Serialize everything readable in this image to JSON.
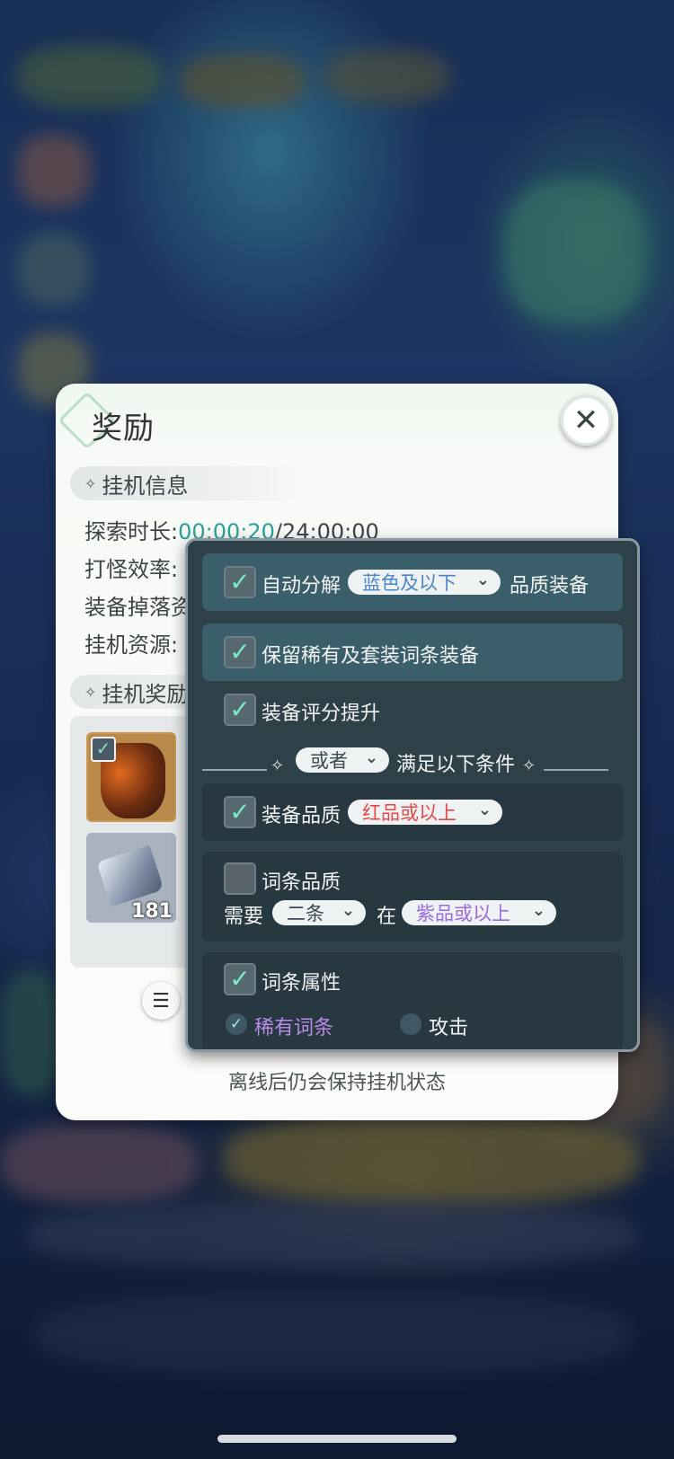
{
  "card": {
    "title": "奖励",
    "close_icon": "✕",
    "idle_info": {
      "section_label": "挂机信息",
      "explore_label": "探索时长:",
      "explore_elapsed": "00:00:20",
      "explore_total": "/24:00:00",
      "kill_rate_label": "打怪效率:",
      "drop_label": "装备掉落资",
      "resource_label": "挂机资源:"
    },
    "rewards": {
      "section_label": "挂机奖励",
      "items": [
        {
          "name": "armor",
          "checked": true
        },
        {
          "name": "ore",
          "count": "181"
        }
      ]
    },
    "offline_note": "离线后仍会保持挂机状态"
  },
  "filter_panel": {
    "auto_salvage": {
      "checked": true,
      "label": "自动分解",
      "dropdown": "蓝色及以下",
      "suffix": "品质装备"
    },
    "keep_rare": {
      "checked": true,
      "label": "保留稀有及套装词条装备"
    },
    "score_up": {
      "checked": true,
      "label": "装备评分提升"
    },
    "divider": {
      "dropdown": "或者",
      "text": "满足以下条件"
    },
    "equip_quality": {
      "checked": true,
      "label": "装备品质",
      "dropdown": "红品或以上"
    },
    "affix_quality": {
      "checked": false,
      "label": "词条品质",
      "need_label": "需要",
      "count_dropdown": "二条",
      "at_label": "在",
      "quality_dropdown": "紫品或以上"
    },
    "affix_attr": {
      "checked": true,
      "label": "词条属性",
      "options": [
        {
          "label": "稀有词条",
          "selected": true
        },
        {
          "label": "攻击",
          "selected": false
        }
      ]
    }
  },
  "colors": {
    "teal_text": "#2aa198",
    "panel_bg": "#2e4048",
    "check_color": "#7de8cc",
    "blue_option": "#4b86c8",
    "red_option": "#e64848",
    "purple_option": "#9b6be0"
  }
}
